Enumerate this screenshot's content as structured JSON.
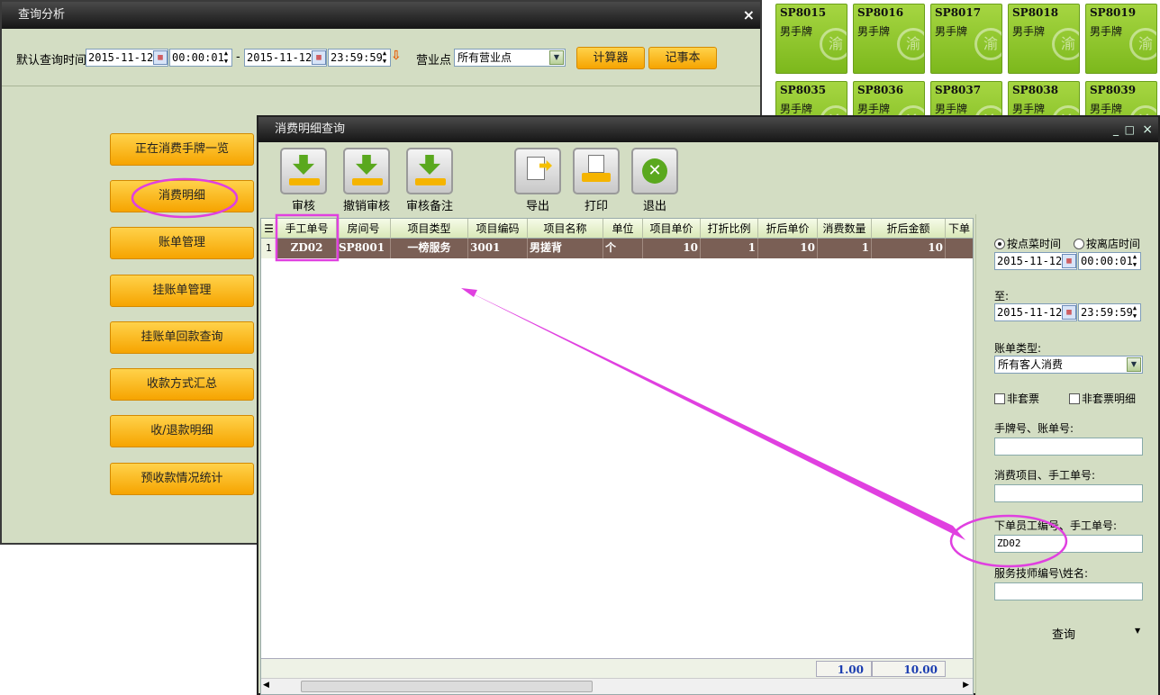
{
  "cards_row1": [
    {
      "code": "SP8015",
      "type": "男手牌"
    },
    {
      "code": "SP8016",
      "type": "男手牌"
    },
    {
      "code": "SP8017",
      "type": "男手牌"
    },
    {
      "code": "SP8018",
      "type": "男手牌"
    },
    {
      "code": "SP8019",
      "type": "男手牌"
    }
  ],
  "cards_row2": [
    {
      "code": "SP8035",
      "type": "男手牌"
    },
    {
      "code": "SP8036",
      "type": "男手牌"
    },
    {
      "code": "SP8037",
      "type": "男手牌"
    },
    {
      "code": "SP8038",
      "type": "男手牌"
    },
    {
      "code": "SP8039",
      "type": "男手牌"
    }
  ],
  "query_window": {
    "title": "查询分析",
    "close": "×",
    "default_time_label": "默认查询时间",
    "start_date": "2015-11-12",
    "start_time": "00:00:01",
    "dash": "-",
    "end_date": "2015-11-12",
    "end_time": "23:59:59",
    "outlet_label": "营业点",
    "outlet_value": "所有营业点",
    "calculator": "计算器",
    "notepad": "记事本",
    "menu": [
      "正在消费手牌一览",
      "消费明细",
      "账单管理",
      "挂账单管理",
      "挂账单回款查询",
      "收款方式汇总",
      "收/退款明细",
      "预收款情况统计"
    ]
  },
  "detail_window": {
    "title": "消费明细查询",
    "controls": [
      "_",
      "□",
      "×"
    ],
    "toolbar": {
      "audit": "审核",
      "cancel_audit": "撤销审核",
      "audit_note": "审核备注",
      "export": "导出",
      "print": "打印",
      "exit": "退出"
    },
    "columns": [
      "手工单号",
      "房间号",
      "项目类型",
      "项目编码",
      "项目名称",
      "单位",
      "项目单价",
      "打折比例",
      "折后单价",
      "消费数量",
      "折后金额",
      "下单"
    ],
    "rows": [
      {
        "num": "1",
        "cells": [
          "ZD02",
          "SP8001",
          "一榜服务",
          "3001",
          "男搓背",
          "个",
          "10",
          "1",
          "10",
          "1",
          "10",
          ""
        ]
      }
    ],
    "totals": {
      "quantity": "1.00",
      "amount": "10.00"
    }
  },
  "filter_panel": {
    "radio_order_time": "按点菜时间",
    "radio_leave_time": "按离店时间",
    "from_date": "2015-11-12",
    "from_time": "00:00:01",
    "to_label": "至:",
    "to_date": "2015-11-12",
    "to_time": "23:59:59",
    "bill_type_label": "账单类型:",
    "bill_type_value": "所有客人消费",
    "non_package": "非套票",
    "non_package_detail": "非套票明细",
    "card_bill_label": "手牌号、账单号:",
    "card_bill_value": "",
    "item_label": "消费项目、手工单号:",
    "item_value": "",
    "staff_label": "下单员工编号、手工单号:",
    "staff_value": "ZD02",
    "tech_label": "服务技师编号\\姓名:",
    "tech_value": "",
    "query": "查询"
  },
  "colors": {
    "highlight": "#e040e0",
    "orange": "#f6a400",
    "green": "#7cb81c",
    "row_selected": "#7a5f55"
  }
}
